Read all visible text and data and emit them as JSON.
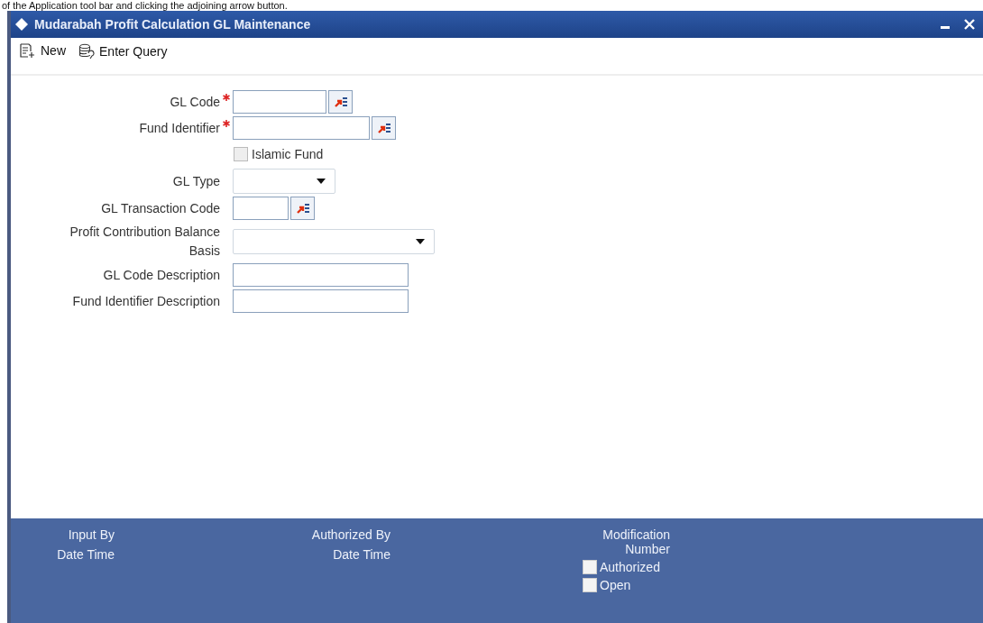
{
  "caption": "of the Application tool bar and clicking the adjoining arrow button.",
  "window": {
    "title": "Mudarabah Profit Calculation GL Maintenance"
  },
  "toolbar": [
    {
      "label": "New"
    },
    {
      "label": "Enter Query"
    }
  ],
  "fields": [
    {
      "kind": "lookup",
      "label": "GL Code",
      "required": true
    },
    {
      "kind": "lookup",
      "label": "Fund Identifier",
      "required": true
    },
    {
      "kind": "checkbox",
      "label": "Islamic Fund",
      "checked": false,
      "disabled": true
    },
    {
      "kind": "select",
      "label": "GL Type"
    },
    {
      "kind": "lookup",
      "label": "GL Transaction Code",
      "required": false
    },
    {
      "kind": "select",
      "label": "Profit Contribution Balance Basis"
    },
    {
      "kind": "text",
      "label": "GL Code Description"
    },
    {
      "kind": "text",
      "label": "Fund Identifier Description"
    }
  ],
  "footer": {
    "columns": [
      [
        "Input By",
        "Date Time"
      ],
      [
        "Authorized By",
        "Date Time"
      ],
      [
        "Modification Number"
      ]
    ],
    "checks": [
      {
        "label": "Authorized",
        "checked": false
      },
      {
        "label": "Open",
        "checked": false
      }
    ]
  }
}
